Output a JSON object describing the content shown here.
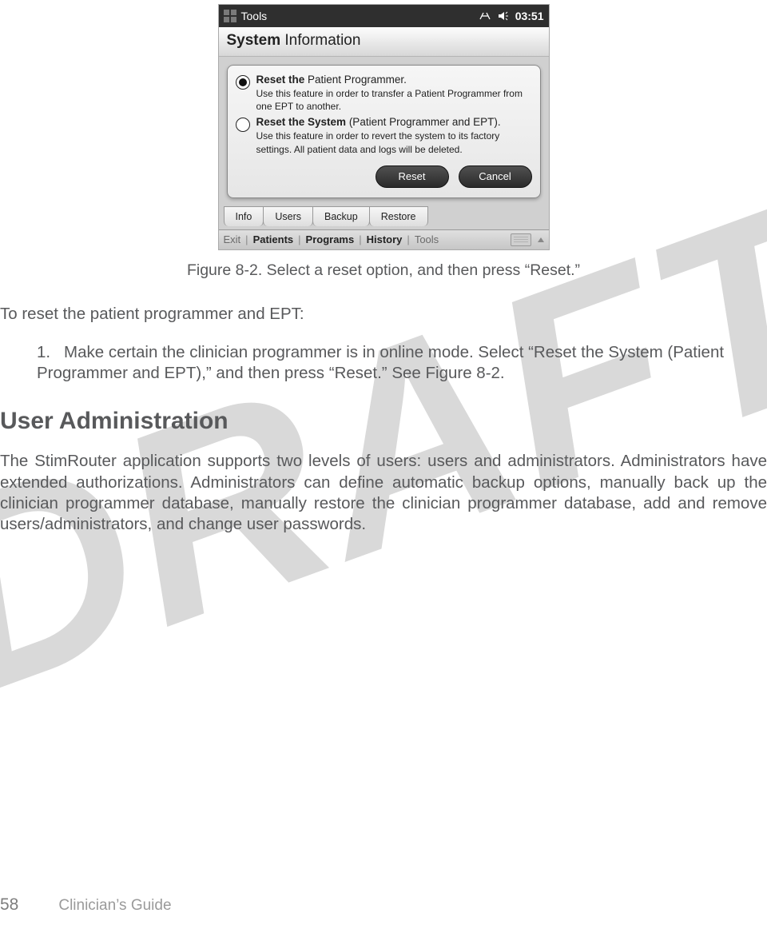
{
  "watermark": "DRAFT",
  "device": {
    "titlebar": {
      "title": "Tools",
      "time": "03:51"
    },
    "heading_bold": "System",
    "heading_rest": " Information",
    "options": [
      {
        "selected": true,
        "title_bold": "Reset the ",
        "title_rest": "Patient Programmer.",
        "desc": "Use this feature in order to transfer a Patient Programmer from one EPT to another."
      },
      {
        "selected": false,
        "title_bold": "Reset the System ",
        "title_rest": "(Patient Programmer and EPT).",
        "desc": "Use this feature in order to revert the system to its factory settings. All patient data and logs will be deleted."
      }
    ],
    "buttons": {
      "reset": "Reset",
      "cancel": "Cancel"
    },
    "tabs": [
      "Info",
      "Users",
      "Backup",
      "Restore"
    ],
    "nav": [
      "Exit",
      "Patients",
      "Programs",
      "History",
      "Tools"
    ]
  },
  "caption": "Figure 8-2. Select a reset option, and then press “Reset.”",
  "intro": "To reset the patient programmer and EPT:",
  "step1": "Make certain the clinician programmer is in online mode. Select “Reset the System (Patient Programmer and EPT),” and then press “Reset.” See Figure 8-2.",
  "section_heading": "User Administration",
  "section_body": "The StimRouter application supports two levels of users: users and administrators. Administrators have extended authorizations. Administrators can define automatic backup options, manually back up the clinician programmer database, manually restore the clinician programmer database, add and remove users/administrators, and change user passwords.",
  "footer": {
    "page": "58",
    "guide": "Clinician’s Guide"
  }
}
